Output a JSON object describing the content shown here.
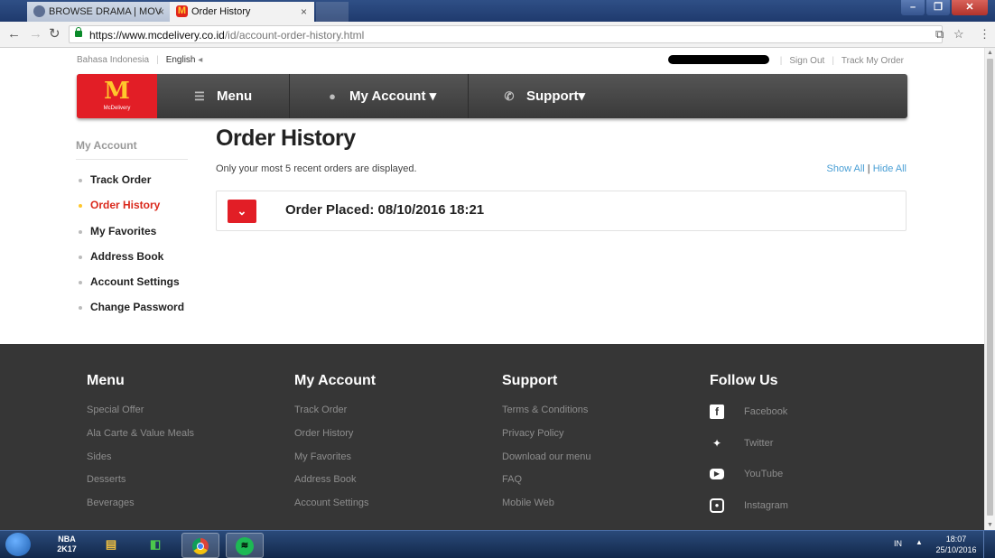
{
  "browser": {
    "tabs": [
      {
        "title": "BROWSE DRAMA | MOV"
      },
      {
        "title": "Order History"
      }
    ],
    "tab_close": "×",
    "url_host": "https://www.mcdelivery.co.id",
    "url_path": "/id/account-order-history.html"
  },
  "util_bar": {
    "lang_id": "Bahasa Indonesia",
    "lang_en": "English",
    "lang_marker": "◂",
    "sign_out": "Sign Out",
    "track_my_order": "Track My Order"
  },
  "nav": {
    "logo_text": "McDelivery",
    "menu": "Menu",
    "my_account": "My Account ▾",
    "support": "Support▾"
  },
  "sidebar": {
    "title": "My Account",
    "items": [
      {
        "label": "Track Order"
      },
      {
        "label": "Order History"
      },
      {
        "label": "My Favorites"
      },
      {
        "label": "Address Book"
      },
      {
        "label": "Account Settings"
      },
      {
        "label": "Change Password"
      }
    ]
  },
  "main": {
    "title": "Order History",
    "subtitle": "Only your most 5 recent orders are displayed.",
    "show_all": "Show All",
    "divider": "|",
    "hide_all": "Hide All",
    "order": {
      "label": "Order Placed: 08/10/2016 18:21"
    }
  },
  "footer": {
    "menu": {
      "title": "Menu",
      "items": [
        "Special Offer",
        "Ala Carte & Value Meals",
        "Sides",
        "Desserts",
        "Beverages"
      ]
    },
    "account": {
      "title": "My Account",
      "items": [
        "Track Order",
        "Order History",
        "My Favorites",
        "Address Book",
        "Account Settings"
      ]
    },
    "support": {
      "title": "Support",
      "items": [
        "Terms & Conditions",
        "Privacy Policy",
        "Download our menu",
        "FAQ",
        "Mobile Web"
      ]
    },
    "follow": {
      "title": "Follow Us",
      "items": [
        "Facebook",
        "Twitter",
        "YouTube",
        "Instagram"
      ]
    }
  },
  "taskbar": {
    "lang": "IN",
    "time": "18:07",
    "date": "25/10/2016"
  },
  "colors": {
    "brand_red": "#e21e26",
    "brand_yellow": "#ffc72c",
    "link_blue": "#4a9fd5",
    "footer_bg": "#363636"
  }
}
